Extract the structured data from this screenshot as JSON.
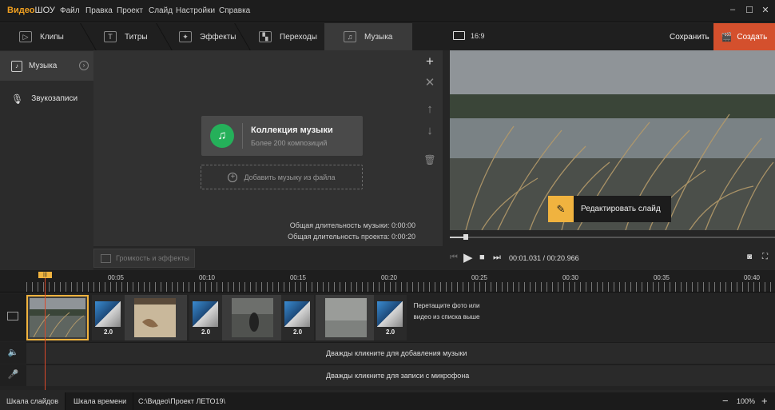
{
  "app": {
    "logo_a": "Видео",
    "logo_b": "ШОУ"
  },
  "menu": [
    "Файл",
    "Правка",
    "Проект",
    "Слайд",
    "Настройки",
    "Справка"
  ],
  "window_controls": {
    "min": "–",
    "max": "☐",
    "close": "✕"
  },
  "tabs": [
    {
      "label": "Клипы",
      "icon": "▷"
    },
    {
      "label": "Титры",
      "icon": "T"
    },
    {
      "label": "Эффекты",
      "icon": "✦"
    },
    {
      "label": "Переходы",
      "icon": "▚"
    },
    {
      "label": "Музыка",
      "icon": "♫"
    }
  ],
  "sidebar": {
    "music": "Музыка",
    "voice": "Звукозаписи"
  },
  "music_panel": {
    "collection_title": "Коллекция музыки",
    "collection_sub": "Более 200 композиций",
    "add_file": "Добавить музыку из файла",
    "total_music": "Общая длительность музыки: 0:00:00",
    "total_project": "Общая длительность проекта: 0:00:20",
    "volume_button": "Громкость и эффекты"
  },
  "panel_controls": {
    "add": "+",
    "remove": "✕",
    "up": "↑",
    "down": "↓",
    "delete": "🗑"
  },
  "header_right": {
    "ratio": "16:9",
    "save": "Сохранить",
    "create": "Создать"
  },
  "preview": {
    "edit_slide": "Редактировать слайд"
  },
  "player": {
    "timecode": "00:01.031 / 00:20.966",
    "progress": 0.05
  },
  "ruler": [
    "00:05",
    "00:10",
    "00:15",
    "00:20",
    "00:25",
    "00:30",
    "00:35",
    "00:40"
  ],
  "transitions": [
    "2.0",
    "2.0",
    "2.0",
    "2.0"
  ],
  "drop_hint": "Перетащите фото или видео из списка выше",
  "lanes": {
    "music": "Дважды кликните для добавления музыки",
    "mic": "Дважды кликните для записи с микрофона"
  },
  "status": {
    "slides": "Шкала слайдов",
    "timeline": "Шкала времени",
    "path": "C:\\Видео\\Проект ЛЕТО19\\",
    "zoom": "100%"
  },
  "colors": {
    "accent": "#f0b33f",
    "create": "#d4502d",
    "music_green": "#25b05a"
  }
}
